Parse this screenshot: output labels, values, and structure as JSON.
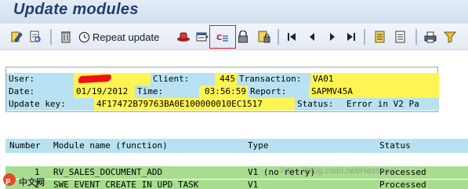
{
  "window": {
    "title": "Update modules"
  },
  "toolbar": {
    "items": [
      {
        "icon": "sap-pencil-note-icon"
      },
      {
        "icon": "display-document-icon"
      },
      {
        "icon": "delete-trash-icon"
      },
      {
        "icon": "repeat-update-clock-icon",
        "label": "Repeat update"
      },
      {
        "icon": "printer-hat-icon"
      },
      {
        "icon": "list-display-icon"
      },
      {
        "icon": "debug-icon",
        "highlighted": true
      },
      {
        "icon": "lock-icon"
      },
      {
        "icon": "lock-document-icon"
      },
      {
        "icon": "first-page-icon"
      },
      {
        "icon": "previous-page-icon"
      },
      {
        "icon": "next-page-icon"
      },
      {
        "icon": "last-page-icon"
      },
      {
        "icon": "details-list-icon"
      },
      {
        "icon": "document-list-icon"
      },
      {
        "icon": "print-icon"
      },
      {
        "icon": "filter-icon"
      }
    ]
  },
  "header": {
    "user_label": "User:",
    "user_value": "",
    "client_label": "Client:",
    "client_value": "445",
    "transaction_label": "Transaction:",
    "transaction_value": "VA01",
    "date_label": "Date:",
    "date_value": "01/19/2012",
    "time_label": "Time:",
    "time_value": "03:56:59",
    "report_label": "Report:",
    "report_value": "SAPMV45A",
    "update_key_label": "Update key:",
    "update_key_value": "4F17472B79763BA0E100000010EC1517",
    "status_label": "Status:",
    "status_value": "Error in V2 Pa"
  },
  "table": {
    "columns": {
      "number": "Number",
      "module": "Module name (function)",
      "type": "Type",
      "status": "Status"
    },
    "rows": [
      {
        "number": "1",
        "module": "RV_SALES_DOCUMENT_ADD",
        "type": "V1 (no retry)",
        "status": "Processed"
      },
      {
        "number": "2",
        "module": "SWE_EVENT_CREATE_IN_UPD_TASK",
        "type": "V1",
        "status": "Processed"
      }
    ]
  },
  "watermark": {
    "text": "https://blog.csdn.net/Hassanal",
    "logo_text": "中文网"
  },
  "colors": {
    "label_bg": "#b8e2f1",
    "value_bg": "#fff454",
    "row_bg": "#a8dc8f",
    "title_color": "#1f3f70",
    "highlight_border": "#d62020"
  }
}
